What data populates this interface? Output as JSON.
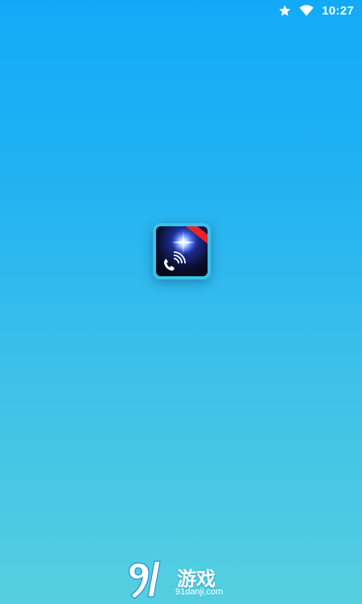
{
  "status_bar": {
    "time": "10:27",
    "icons": [
      "star-icon",
      "wifi-icon"
    ]
  },
  "splash": {
    "app_icon": "flashlight-call-app-icon",
    "ribbon_color": "#e8232a"
  },
  "watermark": {
    "title": "游戏",
    "url": "91danji.com"
  },
  "colors": {
    "background_top": "#12aaf8",
    "background_bottom": "#55cfe0",
    "status_text": "#ffffff"
  }
}
